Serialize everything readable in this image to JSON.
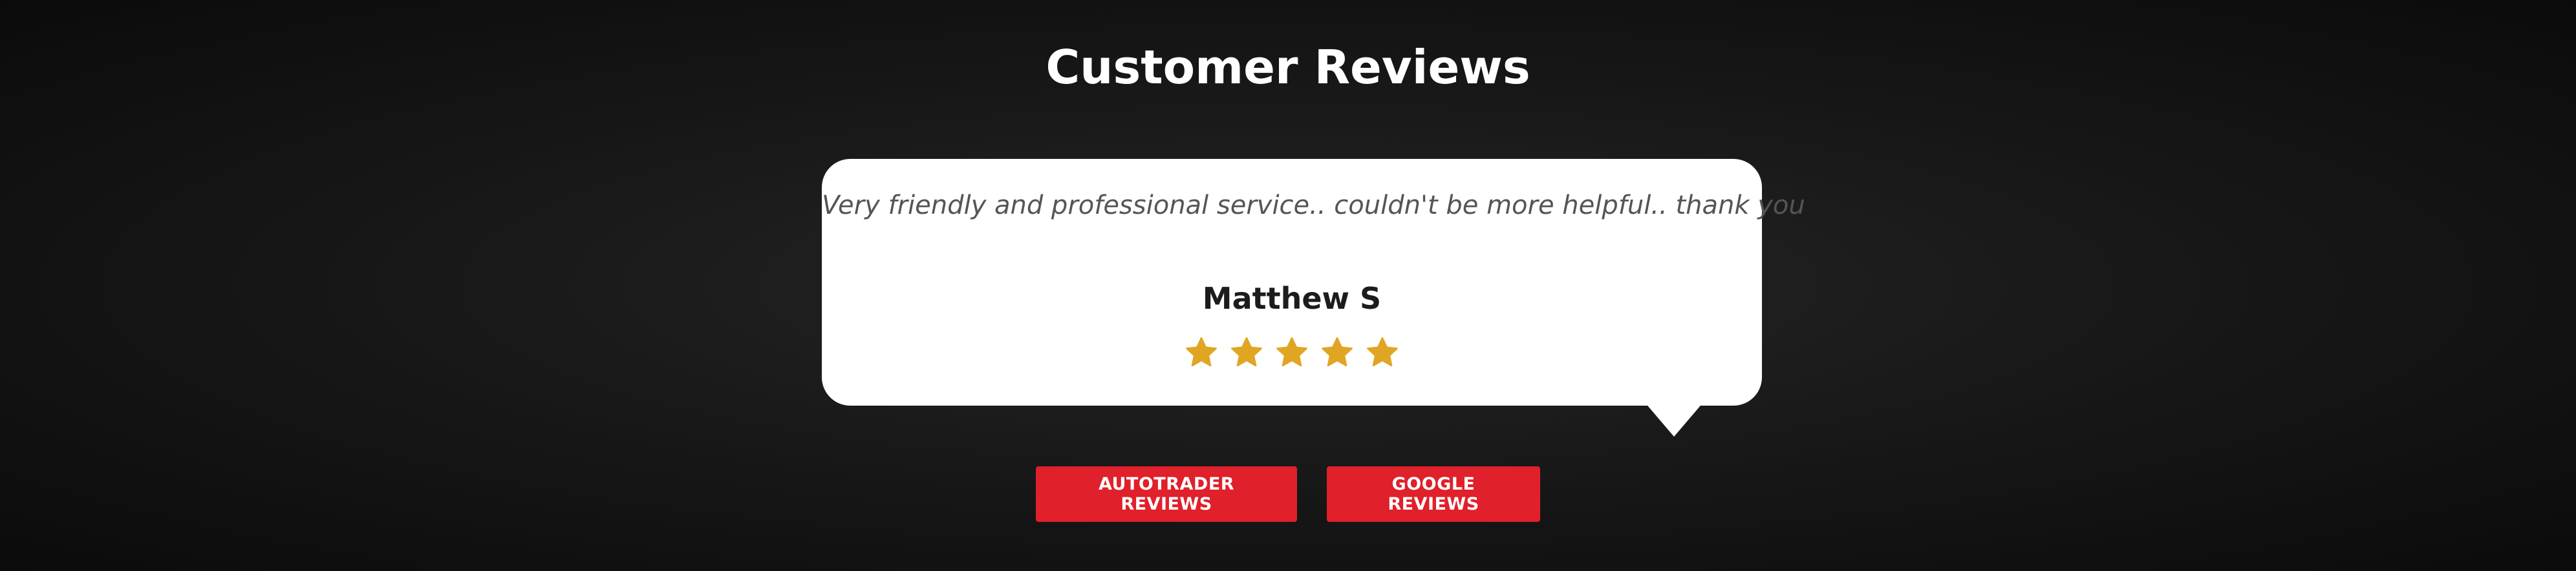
{
  "section": {
    "heading": "Customer Reviews"
  },
  "review": {
    "quote": "Very friendly and professional service.. couldn't be more helpful.. thank you",
    "author": "Matthew S",
    "rating": 5,
    "rating_max": 5,
    "star_color": "#e0a623"
  },
  "buttons": {
    "autotrader_label": "AUTOTRADER REVIEWS",
    "google_label": "GOOGLE REVIEWS",
    "button_color": "#e0202a"
  }
}
